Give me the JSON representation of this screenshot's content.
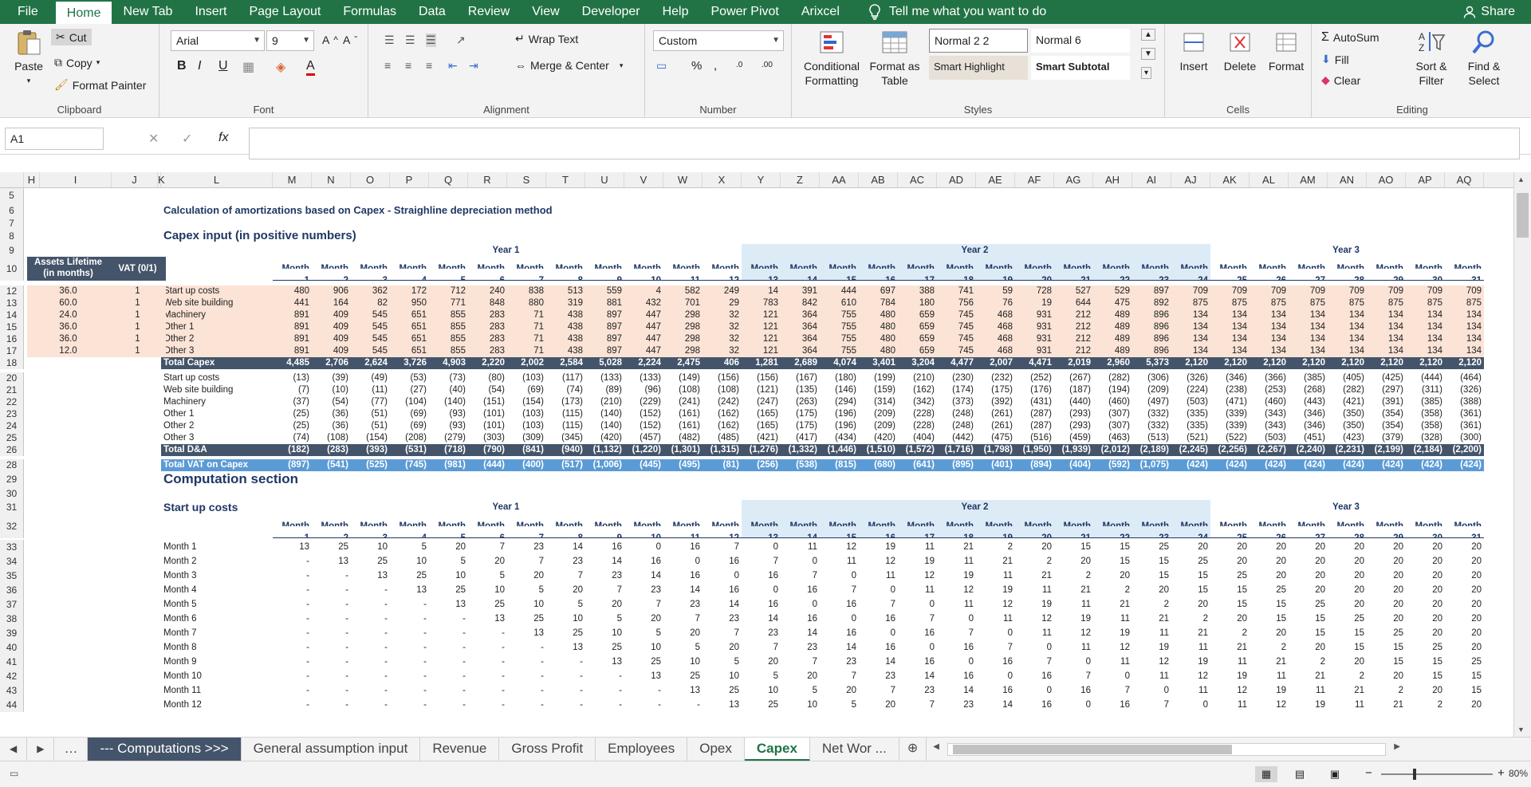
{
  "menu": {
    "file": "File",
    "tabs": [
      "Home",
      "New Tab",
      "Insert",
      "Page Layout",
      "Formulas",
      "Data",
      "Review",
      "View",
      "Developer",
      "Help",
      "Power Pivot",
      "Arixcel"
    ],
    "tell": "Tell me what you want to do",
    "share": "Share"
  },
  "clipboard": {
    "paste": "Paste",
    "cut": "Cut",
    "copy": "Copy",
    "format_painter": "Format Painter",
    "label": "Clipboard"
  },
  "font": {
    "name": "Arial",
    "size": "9",
    "label": "Font",
    "bold": "B",
    "italic": "I",
    "underline": "U"
  },
  "alignment": {
    "wrap": "Wrap Text",
    "merge": "Merge & Center",
    "label": "Alignment"
  },
  "number": {
    "format": "Custom",
    "percent": "%",
    "comma": ",",
    "label": "Number"
  },
  "styles": {
    "conditional": "Conditional",
    "formatting": "Formatting",
    "format_as": "Format as",
    "table": "Table",
    "normal22": "Normal 2 2",
    "normal6": "Normal 6",
    "smart_highlight": "Smart Highlight",
    "smart_subtotal": "Smart Subtotal",
    "label": "Styles"
  },
  "cells": {
    "insert": "Insert",
    "delete": "Delete",
    "format": "Format",
    "label": "Cells"
  },
  "editing": {
    "autosum": "AutoSum",
    "fill": "Fill",
    "clear": "Clear",
    "sort": "Sort &",
    "filter": "Filter",
    "find": "Find &",
    "select": "Select",
    "label": "Editing"
  },
  "formula_bar": {
    "name_box": "A1",
    "fx": "fx",
    "value": ""
  },
  "columns": [
    "H",
    "I",
    "J",
    "K",
    "L",
    "M",
    "N",
    "O",
    "P",
    "Q",
    "R",
    "S",
    "T",
    "U",
    "V",
    "W",
    "X",
    "Y",
    "Z",
    "AA",
    "AB",
    "AC",
    "AD",
    "AE",
    "AF",
    "AG",
    "AH",
    "AI",
    "AJ",
    "AK",
    "AL",
    "AM",
    "AN",
    "AO",
    "AP",
    "AQ"
  ],
  "sheet": {
    "title": "Calculation of amortizations based on Capex - Straighline depreciation method",
    "capex_header": "Capex input (in positive numbers)",
    "computation_header": "Computation section",
    "startup_header": "Start up costs",
    "years": [
      "Year 1",
      "Year 2",
      "Year 3"
    ],
    "month_word": "Month",
    "assets_lifetime": "Assets Lifetime",
    "in_months": "(in months)",
    "vat": "VAT (0/1)",
    "lifetimes": [
      "36.0",
      "60.0",
      "24.0",
      "36.0",
      "36.0",
      "12.0"
    ],
    "vats": [
      "1",
      "1",
      "1",
      "1",
      "1",
      "1"
    ],
    "capex_rows": [
      {
        "label": "Start up costs",
        "values": [
          "480",
          "906",
          "362",
          "172",
          "712",
          "240",
          "838",
          "513",
          "559",
          "4",
          "582",
          "249",
          "14",
          "391",
          "444",
          "697",
          "388",
          "741",
          "59",
          "728",
          "527",
          "529",
          "897",
          "709",
          "709",
          "709",
          "709",
          "709",
          "709",
          "709",
          "709"
        ]
      },
      {
        "label": "Web site building",
        "values": [
          "441",
          "164",
          "82",
          "950",
          "771",
          "848",
          "880",
          "319",
          "881",
          "432",
          "701",
          "29",
          "783",
          "842",
          "610",
          "784",
          "180",
          "756",
          "76",
          "19",
          "644",
          "475",
          "892",
          "875",
          "875",
          "875",
          "875",
          "875",
          "875",
          "875",
          "875"
        ]
      },
      {
        "label": "Machinery",
        "values": [
          "891",
          "409",
          "545",
          "651",
          "855",
          "283",
          "71",
          "438",
          "897",
          "447",
          "298",
          "32",
          "121",
          "364",
          "755",
          "480",
          "659",
          "745",
          "468",
          "931",
          "212",
          "489",
          "896",
          "134",
          "134",
          "134",
          "134",
          "134",
          "134",
          "134",
          "134"
        ]
      },
      {
        "label": "Other 1",
        "values": [
          "891",
          "409",
          "545",
          "651",
          "855",
          "283",
          "71",
          "438",
          "897",
          "447",
          "298",
          "32",
          "121",
          "364",
          "755",
          "480",
          "659",
          "745",
          "468",
          "931",
          "212",
          "489",
          "896",
          "134",
          "134",
          "134",
          "134",
          "134",
          "134",
          "134",
          "134"
        ]
      },
      {
        "label": "Other 2",
        "values": [
          "891",
          "409",
          "545",
          "651",
          "855",
          "283",
          "71",
          "438",
          "897",
          "447",
          "298",
          "32",
          "121",
          "364",
          "755",
          "480",
          "659",
          "745",
          "468",
          "931",
          "212",
          "489",
          "896",
          "134",
          "134",
          "134",
          "134",
          "134",
          "134",
          "134",
          "134"
        ]
      },
      {
        "label": "Other 3",
        "values": [
          "891",
          "409",
          "545",
          "651",
          "855",
          "283",
          "71",
          "438",
          "897",
          "447",
          "298",
          "32",
          "121",
          "364",
          "755",
          "480",
          "659",
          "745",
          "468",
          "931",
          "212",
          "489",
          "896",
          "134",
          "134",
          "134",
          "134",
          "134",
          "134",
          "134",
          "134"
        ]
      }
    ],
    "total_capex": {
      "label": "Total Capex",
      "values": [
        "4,485",
        "2,706",
        "2,624",
        "3,726",
        "4,903",
        "2,220",
        "2,002",
        "2,584",
        "5,028",
        "2,224",
        "2,475",
        "406",
        "1,281",
        "2,689",
        "4,074",
        "3,401",
        "3,204",
        "4,477",
        "2,007",
        "4,471",
        "2,019",
        "2,960",
        "5,373",
        "2,120",
        "2,120",
        "2,120",
        "2,120",
        "2,120",
        "2,120",
        "2,120",
        "2,120"
      ]
    },
    "da_rows": [
      {
        "label": "Start up costs",
        "values": [
          "(13)",
          "(39)",
          "(49)",
          "(53)",
          "(73)",
          "(80)",
          "(103)",
          "(117)",
          "(133)",
          "(133)",
          "(149)",
          "(156)",
          "(156)",
          "(167)",
          "(180)",
          "(199)",
          "(210)",
          "(230)",
          "(232)",
          "(252)",
          "(267)",
          "(282)",
          "(306)",
          "(326)",
          "(346)",
          "(366)",
          "(385)",
          "(405)",
          "(425)",
          "(444)",
          "(464)"
        ]
      },
      {
        "label": "Web site building",
        "values": [
          "(7)",
          "(10)",
          "(11)",
          "(27)",
          "(40)",
          "(54)",
          "(69)",
          "(74)",
          "(89)",
          "(96)",
          "(108)",
          "(108)",
          "(121)",
          "(135)",
          "(146)",
          "(159)",
          "(162)",
          "(174)",
          "(175)",
          "(176)",
          "(187)",
          "(194)",
          "(209)",
          "(224)",
          "(238)",
          "(253)",
          "(268)",
          "(282)",
          "(297)",
          "(311)",
          "(326)"
        ]
      },
      {
        "label": "Machinery",
        "values": [
          "(37)",
          "(54)",
          "(77)",
          "(104)",
          "(140)",
          "(151)",
          "(154)",
          "(173)",
          "(210)",
          "(229)",
          "(241)",
          "(242)",
          "(247)",
          "(263)",
          "(294)",
          "(314)",
          "(342)",
          "(373)",
          "(392)",
          "(431)",
          "(440)",
          "(460)",
          "(497)",
          "(503)",
          "(471)",
          "(460)",
          "(443)",
          "(421)",
          "(391)",
          "(385)",
          "(388)"
        ]
      },
      {
        "label": "Other 1",
        "values": [
          "(25)",
          "(36)",
          "(51)",
          "(69)",
          "(93)",
          "(101)",
          "(103)",
          "(115)",
          "(140)",
          "(152)",
          "(161)",
          "(162)",
          "(165)",
          "(175)",
          "(196)",
          "(209)",
          "(228)",
          "(248)",
          "(261)",
          "(287)",
          "(293)",
          "(307)",
          "(332)",
          "(335)",
          "(339)",
          "(343)",
          "(346)",
          "(350)",
          "(354)",
          "(358)",
          "(361)"
        ]
      },
      {
        "label": "Other 2",
        "values": [
          "(25)",
          "(36)",
          "(51)",
          "(69)",
          "(93)",
          "(101)",
          "(103)",
          "(115)",
          "(140)",
          "(152)",
          "(161)",
          "(162)",
          "(165)",
          "(175)",
          "(196)",
          "(209)",
          "(228)",
          "(248)",
          "(261)",
          "(287)",
          "(293)",
          "(307)",
          "(332)",
          "(335)",
          "(339)",
          "(343)",
          "(346)",
          "(350)",
          "(354)",
          "(358)",
          "(361)"
        ]
      },
      {
        "label": "Other 3",
        "values": [
          "(74)",
          "(108)",
          "(154)",
          "(208)",
          "(279)",
          "(303)",
          "(309)",
          "(345)",
          "(420)",
          "(457)",
          "(482)",
          "(485)",
          "(421)",
          "(417)",
          "(434)",
          "(420)",
          "(404)",
          "(442)",
          "(475)",
          "(516)",
          "(459)",
          "(463)",
          "(513)",
          "(521)",
          "(522)",
          "(503)",
          "(451)",
          "(423)",
          "(379)",
          "(328)",
          "(300)"
        ]
      }
    ],
    "total_da": {
      "label": "Total D&A",
      "values": [
        "(182)",
        "(283)",
        "(393)",
        "(531)",
        "(718)",
        "(790)",
        "(841)",
        "(940)",
        "(1,132)",
        "(1,220)",
        "(1,301)",
        "(1,315)",
        "(1,276)",
        "(1,332)",
        "(1,446)",
        "(1,510)",
        "(1,572)",
        "(1,716)",
        "(1,798)",
        "(1,950)",
        "(1,939)",
        "(2,012)",
        "(2,189)",
        "(2,245)",
        "(2,256)",
        "(2,267)",
        "(2,240)",
        "(2,231)",
        "(2,199)",
        "(2,184)",
        "(2,200)"
      ]
    },
    "total_vat": {
      "label": "Total VAT on Capex",
      "values": [
        "(897)",
        "(541)",
        "(525)",
        "(745)",
        "(981)",
        "(444)",
        "(400)",
        "(517)",
        "(1,006)",
        "(445)",
        "(495)",
        "(81)",
        "(256)",
        "(538)",
        "(815)",
        "(680)",
        "(641)",
        "(895)",
        "(401)",
        "(894)",
        "(404)",
        "(592)",
        "(1,075)",
        "(424)",
        "(424)",
        "(424)",
        "(424)",
        "(424)",
        "(424)",
        "(424)",
        "(424)"
      ]
    },
    "startup_rows": [
      {
        "label": "Month 1",
        "values": [
          "13",
          "25",
          "10",
          "5",
          "20",
          "7",
          "23",
          "14",
          "16",
          "0",
          "16",
          "7",
          "0",
          "11",
          "12",
          "19",
          "11",
          "21",
          "2",
          "20",
          "15",
          "15",
          "25",
          "20",
          "20",
          "20",
          "20",
          "20",
          "20",
          "20",
          "20"
        ]
      },
      {
        "label": "Month 2",
        "values": [
          "-",
          "13",
          "25",
          "10",
          "5",
          "20",
          "7",
          "23",
          "14",
          "16",
          "0",
          "16",
          "7",
          "0",
          "11",
          "12",
          "19",
          "11",
          "21",
          "2",
          "20",
          "15",
          "15",
          "25",
          "20",
          "20",
          "20",
          "20",
          "20",
          "20",
          "20"
        ]
      },
      {
        "label": "Month 3",
        "values": [
          "-",
          "-",
          "13",
          "25",
          "10",
          "5",
          "20",
          "7",
          "23",
          "14",
          "16",
          "0",
          "16",
          "7",
          "0",
          "11",
          "12",
          "19",
          "11",
          "21",
          "2",
          "20",
          "15",
          "15",
          "25",
          "20",
          "20",
          "20",
          "20",
          "20",
          "20"
        ]
      },
      {
        "label": "Month 4",
        "values": [
          "-",
          "-",
          "-",
          "13",
          "25",
          "10",
          "5",
          "20",
          "7",
          "23",
          "14",
          "16",
          "0",
          "16",
          "7",
          "0",
          "11",
          "12",
          "19",
          "11",
          "21",
          "2",
          "20",
          "15",
          "15",
          "25",
          "20",
          "20",
          "20",
          "20",
          "20"
        ]
      },
      {
        "label": "Month 5",
        "values": [
          "-",
          "-",
          "-",
          "-",
          "13",
          "25",
          "10",
          "5",
          "20",
          "7",
          "23",
          "14",
          "16",
          "0",
          "16",
          "7",
          "0",
          "11",
          "12",
          "19",
          "11",
          "21",
          "2",
          "20",
          "15",
          "15",
          "25",
          "20",
          "20",
          "20",
          "20"
        ]
      },
      {
        "label": "Month 6",
        "values": [
          "-",
          "-",
          "-",
          "-",
          "-",
          "13",
          "25",
          "10",
          "5",
          "20",
          "7",
          "23",
          "14",
          "16",
          "0",
          "16",
          "7",
          "0",
          "11",
          "12",
          "19",
          "11",
          "21",
          "2",
          "20",
          "15",
          "15",
          "25",
          "20",
          "20",
          "20"
        ]
      },
      {
        "label": "Month 7",
        "values": [
          "-",
          "-",
          "-",
          "-",
          "-",
          "-",
          "13",
          "25",
          "10",
          "5",
          "20",
          "7",
          "23",
          "14",
          "16",
          "0",
          "16",
          "7",
          "0",
          "11",
          "12",
          "19",
          "11",
          "21",
          "2",
          "20",
          "15",
          "15",
          "25",
          "20",
          "20"
        ]
      },
      {
        "label": "Month 8",
        "values": [
          "-",
          "-",
          "-",
          "-",
          "-",
          "-",
          "-",
          "13",
          "25",
          "10",
          "5",
          "20",
          "7",
          "23",
          "14",
          "16",
          "0",
          "16",
          "7",
          "0",
          "11",
          "12",
          "19",
          "11",
          "21",
          "2",
          "20",
          "15",
          "15",
          "25",
          "20"
        ]
      },
      {
        "label": "Month 9",
        "values": [
          "-",
          "-",
          "-",
          "-",
          "-",
          "-",
          "-",
          "-",
          "13",
          "25",
          "10",
          "5",
          "20",
          "7",
          "23",
          "14",
          "16",
          "0",
          "16",
          "7",
          "0",
          "11",
          "12",
          "19",
          "11",
          "21",
          "2",
          "20",
          "15",
          "15",
          "25"
        ]
      },
      {
        "label": "Month 10",
        "values": [
          "-",
          "-",
          "-",
          "-",
          "-",
          "-",
          "-",
          "-",
          "-",
          "13",
          "25",
          "10",
          "5",
          "20",
          "7",
          "23",
          "14",
          "16",
          "0",
          "16",
          "7",
          "0",
          "11",
          "12",
          "19",
          "11",
          "21",
          "2",
          "20",
          "15",
          "15"
        ]
      },
      {
        "label": "Month 11",
        "values": [
          "-",
          "-",
          "-",
          "-",
          "-",
          "-",
          "-",
          "-",
          "-",
          "-",
          "13",
          "25",
          "10",
          "5",
          "20",
          "7",
          "23",
          "14",
          "16",
          "0",
          "16",
          "7",
          "0",
          "11",
          "12",
          "19",
          "11",
          "21",
          "2",
          "20",
          "15"
        ]
      },
      {
        "label": "Month 12",
        "values": [
          "-",
          "-",
          "-",
          "-",
          "-",
          "-",
          "-",
          "-",
          "-",
          "-",
          "-",
          "13",
          "25",
          "10",
          "5",
          "20",
          "7",
          "23",
          "14",
          "16",
          "0",
          "16",
          "7",
          "0",
          "11",
          "12",
          "19",
          "11",
          "21",
          "2",
          "20"
        ]
      }
    ],
    "row_numbers": [
      "5",
      "6",
      "7",
      "8",
      "9",
      "10",
      "12",
      "13",
      "14",
      "15",
      "16",
      "17",
      "18",
      "20",
      "21",
      "22",
      "23",
      "24",
      "25",
      "26",
      "28",
      "29",
      "30",
      "31",
      "32",
      "33",
      "34",
      "35",
      "36",
      "37",
      "38",
      "39",
      "40",
      "41",
      "42",
      "43",
      "44"
    ]
  },
  "sheet_tabs": [
    "--- Computations >>>",
    "General assumption input",
    "Revenue",
    "Gross Profit",
    "Employees",
    "Opex",
    "Capex",
    "Net Wor ..."
  ],
  "active_tab": "Capex",
  "status": {
    "zoom": "80%"
  },
  "colors": {
    "excel_green": "#217346",
    "navy": "#44546a",
    "peach": "#fbe3d6",
    "blue_total": "#5b9bd5",
    "light_blue": "#ddebf7"
  }
}
